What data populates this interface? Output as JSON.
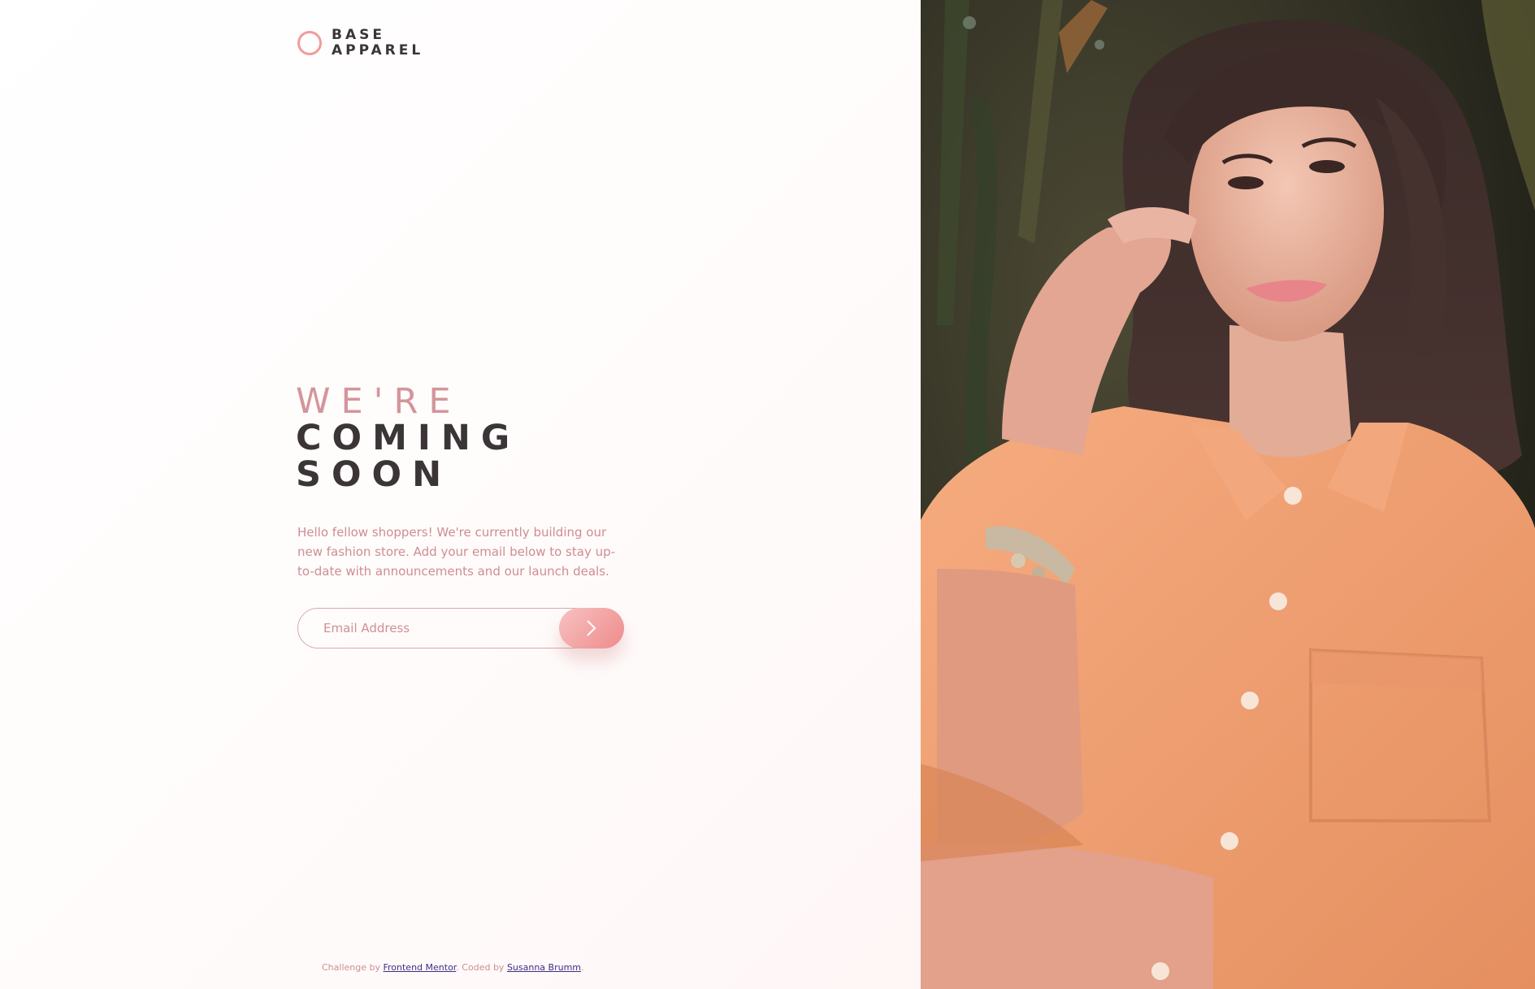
{
  "brand": {
    "line1": "BASE",
    "line2": "APPAREL"
  },
  "hero": {
    "title_light": "WE'RE",
    "title_bold_1": "COMING",
    "title_bold_2": "SOON",
    "intro": "Hello fellow shoppers! We're currently building our new fashion store. Add your email below to stay up-to-date with announcements and our launch deals."
  },
  "form": {
    "email_placeholder": "Email Address",
    "submit_icon": "chevron-right-icon"
  },
  "footer": {
    "prefix": "Challenge by ",
    "challenge_link": "Frontend Mentor",
    "middle": ". Coded by ",
    "author_link": "Susanna Brumm",
    "suffix": "."
  },
  "colors": {
    "accent_pink": "#f29b9b",
    "text_pink": "#cf8d92",
    "dark": "#3b3537",
    "shirt": "#f0a173"
  },
  "image": {
    "subject": "hero-photo"
  }
}
